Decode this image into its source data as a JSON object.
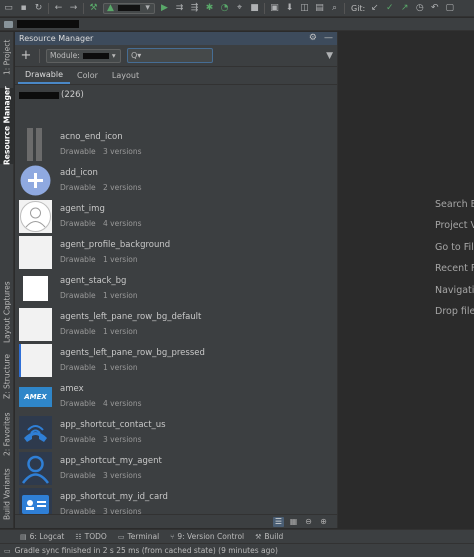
{
  "toolbar": {
    "git_label": "Git:"
  },
  "stripe": {
    "tabs": [
      {
        "label": "1: Project"
      },
      {
        "label": "Resource Manager"
      },
      {
        "label": "Layout Captures"
      },
      {
        "label": "Z: Structure"
      },
      {
        "label": "2: Favorites"
      },
      {
        "label": "Build Variants"
      }
    ]
  },
  "panel": {
    "title": "Resource Manager",
    "module_label": "Module:",
    "search_placeholder": "Q▾",
    "tabs": [
      "Drawable",
      "Color",
      "Layout"
    ],
    "selected_tab": "Drawable",
    "section_count": "(226)"
  },
  "resources": [
    {
      "name": "acno_end_icon",
      "type": "Drawable",
      "versions": "3 versions",
      "thumb": "bars"
    },
    {
      "name": "add_icon",
      "type": "Drawable",
      "versions": "2 versions",
      "thumb": "plus-circle"
    },
    {
      "name": "agent_img",
      "type": "Drawable",
      "versions": "4 versions",
      "thumb": "person-outline"
    },
    {
      "name": "agent_profile_background",
      "type": "Drawable",
      "versions": "1 version",
      "thumb": "white"
    },
    {
      "name": "agent_stack_bg",
      "type": "Drawable",
      "versions": "1 version",
      "thumb": "white-framed"
    },
    {
      "name": "agents_left_pane_row_bg_default",
      "type": "Drawable",
      "versions": "1 version",
      "thumb": "white"
    },
    {
      "name": "agents_left_pane_row_bg_pressed",
      "type": "Drawable",
      "versions": "1 version",
      "thumb": "white-blue-edge"
    },
    {
      "name": "amex",
      "type": "Drawable",
      "versions": "4 versions",
      "thumb": "amex",
      "thumb_text": "AMEX"
    },
    {
      "name": "app_shortcut_contact_us",
      "type": "Drawable",
      "versions": "3 versions",
      "thumb": "phone"
    },
    {
      "name": "app_shortcut_my_agent",
      "type": "Drawable",
      "versions": "3 versions",
      "thumb": "person-blue"
    },
    {
      "name": "app_shortcut_my_id_card",
      "type": "Drawable",
      "versions": "3 versions",
      "thumb": "id-card"
    }
  ],
  "editor_hints": [
    "Search E",
    "Project V",
    "Go to Fil",
    "Recent F",
    "Navigati",
    "Drop file"
  ],
  "bottombar": {
    "items": [
      "6: Logcat",
      "TODO",
      "Terminal",
      "9: Version Control",
      "Build"
    ]
  },
  "status": {
    "message": "Gradle sync finished in 2 s 25 ms (from cached state) (9 minutes ago)"
  },
  "colors": {
    "panel_bg": "#3c3f41",
    "editor_bg": "#2b2b2b",
    "header_bg": "#3d4b5c",
    "accent": "#4a88c7",
    "run_green": "#59a869"
  }
}
